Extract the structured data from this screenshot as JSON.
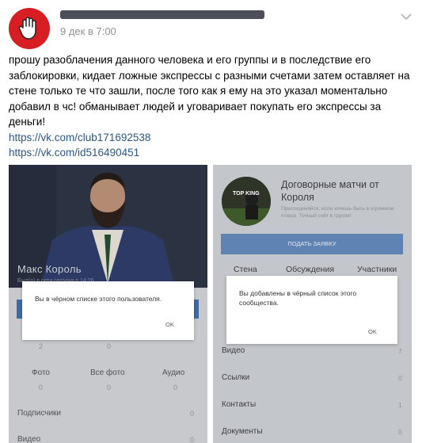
{
  "post": {
    "author_name": "███████████████████████████",
    "date": "9 дек в 7:00",
    "text": "прошу разоблачения данного человека и его группы и в последствие его заблокировки, кидает ложные экспрессы с разными счетами затем оставляет на стене только те что зашли, после того как я ему на это указал моментально добавил в чс! обманывает людей и уговаривает покупать его экспрессы за деньги!",
    "links": [
      "https://vk.com/club171692538",
      "https://vk.com/id516490451"
    ]
  },
  "left_shot": {
    "profile_name": "Макс Король",
    "profile_sub": "Был(а) в сети сегодня в 14:26",
    "stat_top": [
      "2",
      "0"
    ],
    "media_tabs": [
      {
        "label": "Фото",
        "count": "0"
      },
      {
        "label": "Все фото",
        "count": "0"
      },
      {
        "label": "Аудио",
        "count": "0"
      }
    ],
    "rows": [
      {
        "label": "Подписчики",
        "count": "0"
      },
      {
        "label": "Видео",
        "count": "0"
      }
    ],
    "dialog": {
      "message": "Вы в чёрном списке этого пользователя.",
      "ok": "OK"
    }
  },
  "right_shot": {
    "group_badge": "TOP KING",
    "group_title": "Договорные матчи от Короля",
    "group_desc": "Присоединяйся, если хочешь быть в огромном плюсе. Точный счёт в группе!",
    "join_button": "ПОДАТЬ ЗАЯВКУ",
    "tabs": [
      "Стена",
      "Обсуждения",
      "Участники"
    ],
    "rows": [
      {
        "label": "Видео",
        "count": "7"
      },
      {
        "label": "Ссылки",
        "count": "0"
      },
      {
        "label": "Контакты",
        "count": "1"
      },
      {
        "label": "Документы",
        "count": "0"
      }
    ],
    "dialog": {
      "message": "Вы добавлены в чёрный список этого сообщества.",
      "ok": "OK"
    }
  },
  "colors": {
    "avatar": "#d61e23",
    "link": "#2a5885",
    "date": "#939393"
  },
  "icons": [
    "stop-hand-icon",
    "chevron-down-icon"
  ]
}
